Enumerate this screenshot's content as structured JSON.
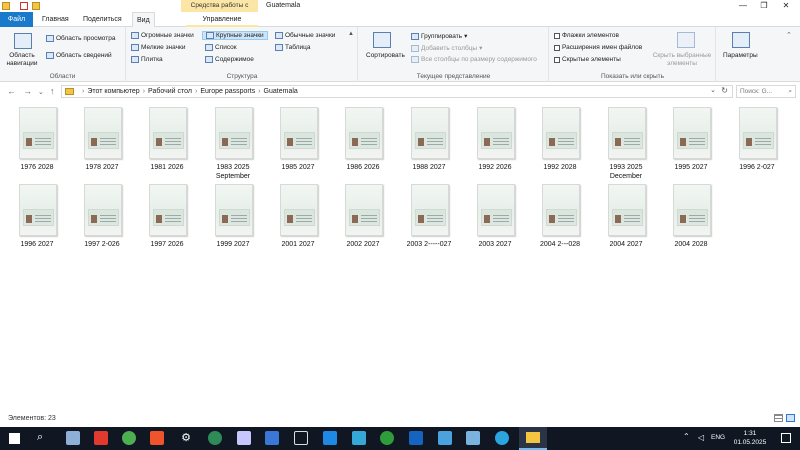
{
  "window": {
    "title": "Guatemala",
    "context_tab_header": "Средства работы с рисунками",
    "controls": [
      "—",
      "❐",
      "✕"
    ]
  },
  "tabs": {
    "file": "Файл",
    "home": "Главная",
    "share": "Поделиться",
    "view": "Вид",
    "manage": "Управление"
  },
  "ribbon": {
    "panes": {
      "label": "Области",
      "nav_pane": "Область навигации",
      "preview_pane": "Область просмотра",
      "details_pane": "Область сведений"
    },
    "layout": {
      "label": "Структура",
      "items": [
        "Огромные значки",
        "Крупные значки",
        "Обычные значки",
        "Мелкие значки",
        "Список",
        "Таблица",
        "Плитка",
        "Содержимое"
      ]
    },
    "current_view": {
      "label": "Текущее представление",
      "sort": "Сортировать",
      "group": "Группировать",
      "add_columns": "Добавить столбцы",
      "fit_columns": "Все столбцы по размеру содержимого"
    },
    "show_hide": {
      "label": "Показать или скрыть",
      "item_checkboxes": "Флажки элементов",
      "file_extensions": "Расширения имен файлов",
      "hidden_items": "Скрытые элементы",
      "hide_selected": "Скрыть выбранные элементы"
    },
    "options": "Параметры"
  },
  "address": {
    "crumbs": [
      "Этот компьютер",
      "Рабочий стол",
      "Europe passports",
      "Guatemala"
    ],
    "search_placeholder": "Поиск: G..."
  },
  "files": [
    {
      "name": "1976 2028"
    },
    {
      "name": "1978 2027"
    },
    {
      "name": "1981 2026"
    },
    {
      "name": "1983 2025 September"
    },
    {
      "name": "1985 2027"
    },
    {
      "name": "1986 2026"
    },
    {
      "name": "1988 2027"
    },
    {
      "name": "1992 2026"
    },
    {
      "name": "1992 2028"
    },
    {
      "name": "1993 2025 December"
    },
    {
      "name": "1995 2027"
    },
    {
      "name": "1996 2-027"
    },
    {
      "name": "1996 2027"
    },
    {
      "name": "1997 2-026"
    },
    {
      "name": "1997 2026"
    },
    {
      "name": "1999 2027"
    },
    {
      "name": "2001 2027"
    },
    {
      "name": "2002 2027"
    },
    {
      "name": "2003 2-----027"
    },
    {
      "name": "2003 2027"
    },
    {
      "name": "2004 2---028"
    },
    {
      "name": "2004 2027"
    },
    {
      "name": "2004 2028"
    }
  ],
  "status": {
    "items_count": "Элементов: 23"
  },
  "taskbar": {
    "lang": "ENG",
    "time": "1:31",
    "date": "01.05.2025"
  }
}
